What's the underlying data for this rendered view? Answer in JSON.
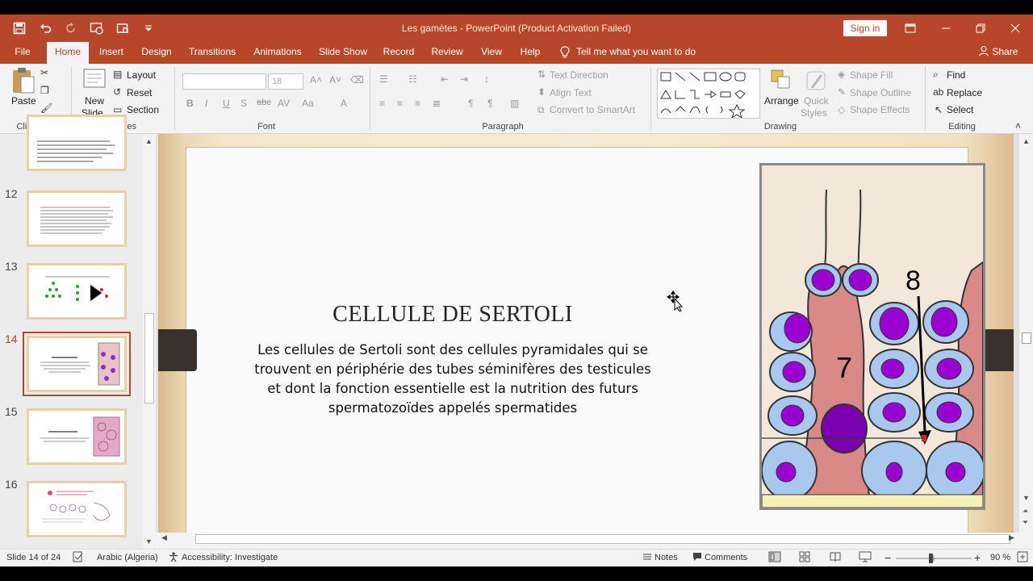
{
  "window": {
    "title": "Les gamètes  -  PowerPoint (Product Activation Failed)",
    "sign_in": "Sign in",
    "accent": "#b7472a"
  },
  "menu": {
    "tabs": [
      "File",
      "Home",
      "Insert",
      "Design",
      "Transitions",
      "Animations",
      "Slide Show",
      "Record",
      "Review",
      "View",
      "Help"
    ],
    "active": "Home",
    "tell_me": "Tell me what you want to do",
    "share": "Share"
  },
  "ribbon": {
    "clipboard": {
      "paste": "Paste",
      "group": "Clipboard"
    },
    "slides": {
      "new_slide_1": "New",
      "new_slide_2": "Slide",
      "layout": "Layout",
      "reset": "Reset",
      "section": "Section",
      "group": "Slides"
    },
    "font": {
      "size": "18",
      "group": "Font",
      "bold": "B",
      "italic": "I",
      "underline": "U",
      "strike": "abc",
      "shadow": "S"
    },
    "paragraph": {
      "text_direction": "Text Direction",
      "align_text": "Align Text",
      "convert_smartart": "Convert to SmartArt",
      "group": "Paragraph"
    },
    "drawing": {
      "arrange": "Arrange",
      "quick_styles_1": "Quick",
      "quick_styles_2": "Styles",
      "shape_fill": "Shape Fill",
      "shape_outline": "Shape Outline",
      "shape_effects": "Shape Effects",
      "group": "Drawing"
    },
    "editing": {
      "find": "Find",
      "replace": "Replace",
      "select": "Select",
      "group": "Editing"
    }
  },
  "thumbnails": [
    {
      "num": "",
      "kind": "text"
    },
    {
      "num": "12",
      "kind": "text"
    },
    {
      "num": "13",
      "kind": "diagram"
    },
    {
      "num": "14",
      "kind": "current"
    },
    {
      "num": "15",
      "kind": "image"
    },
    {
      "num": "16",
      "kind": "chart"
    }
  ],
  "slide": {
    "title": "CELLULE DE SERTOLI",
    "body": "Les cellules de Sertoli sont des cellules pyramidales qui se trouvent en périphérie des tubes séminifères des testicules et dont la fonction essentielle est la nutrition des futurs spermatozoïdes appelés spermatides",
    "figure": {
      "label_7": "7",
      "label_8": "8"
    }
  },
  "status": {
    "slide_count": "Slide 14 of 24",
    "language": "Arabic (Algeria)",
    "accessibility": "Accessibility: Investigate",
    "notes": "Notes",
    "comments": "Comments",
    "zoom": "90 %"
  }
}
